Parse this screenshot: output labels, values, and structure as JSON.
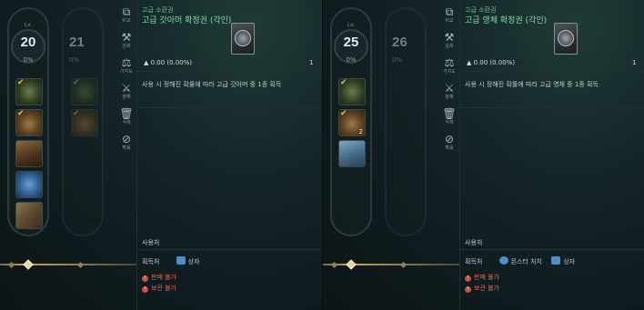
{
  "panels": [
    {
      "level_label": "Lv.",
      "level": "20",
      "level_pct": "0%",
      "next_level": "21",
      "next_pct": "0%",
      "rail": [
        {
          "label": "비교",
          "icon": "compare-icon"
        },
        {
          "label": "강화",
          "icon": "enhance-hammer-icon"
        },
        {
          "label": "가치도",
          "icon": "scale-icon"
        },
        {
          "label": "분해",
          "icon": "dismantle-icon"
        },
        {
          "label": "삭제",
          "icon": "trash-icon"
        },
        {
          "label": "확률",
          "icon": "probability-icon"
        }
      ],
      "slots": [
        {
          "color": "green",
          "checked": true
        },
        {
          "color": "brown",
          "checked": true
        },
        {
          "color": "brown2",
          "checked": false
        },
        {
          "color": "blue",
          "checked": false
        },
        {
          "color": "tan",
          "checked": false
        }
      ],
      "item": {
        "category": "고급 소환권",
        "name": "고급 갓아머 확정권 (각인)",
        "chance": "0.00 (0.00%)",
        "quantity": "1",
        "description": "사용 시 정해진 확률에 따라 고급 갓아머 중 1종 획득"
      },
      "source_title": "사용처",
      "obtain_label": "획득처",
      "sources": [
        {
          "text": "상자",
          "icon": "chest-icon",
          "color": "#4f8fc8"
        }
      ],
      "warnings": [
        "판매 불가",
        "보관 불가"
      ]
    },
    {
      "level_label": "Lv.",
      "level": "25",
      "level_pct": "0%",
      "next_level": "26",
      "next_pct": "0%",
      "rail": [
        {
          "label": "비교",
          "icon": "compare-icon"
        },
        {
          "label": "강화",
          "icon": "enhance-hammer-icon"
        },
        {
          "label": "가치도",
          "icon": "scale-icon"
        },
        {
          "label": "분해",
          "icon": "dismantle-icon"
        },
        {
          "label": "삭제",
          "icon": "trash-icon"
        },
        {
          "label": "확률",
          "icon": "probability-icon"
        }
      ],
      "slots": [
        {
          "color": "green",
          "checked": true
        },
        {
          "color": "brown",
          "checked": true,
          "count": "2"
        },
        {
          "color": "sky",
          "checked": false
        }
      ],
      "item": {
        "category": "고급 소환권",
        "name": "고급 영체 확정권 (각인)",
        "chance": "0.00 (0.00%)",
        "quantity": "1",
        "description": "사용 시 정해진 확률에 따라 고급 영체 중 1종 획득"
      },
      "source_title": "사용처",
      "obtain_label": "획득처",
      "sources": [
        {
          "text": "몬스터 처치",
          "icon": "monster-icon",
          "color": "#4f8fc8"
        },
        {
          "text": "상자",
          "icon": "chest-icon",
          "color": "#4f8fc8"
        }
      ],
      "warnings": [
        "판매 불가",
        "보관 불가"
      ]
    }
  ]
}
